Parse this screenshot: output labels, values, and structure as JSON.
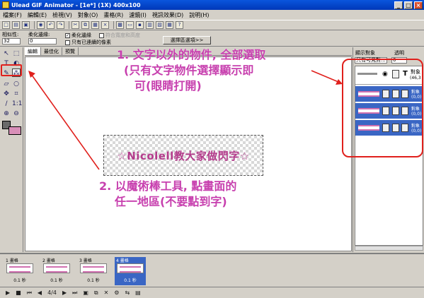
{
  "window": {
    "title": "Ulead GIF Animator - [1e*] (1X) 400x100",
    "minimize": "_",
    "maximize": "□",
    "close": "×"
  },
  "menu": [
    "檔案(F)",
    "編輯(E)",
    "檢視(V)",
    "對象(O)",
    "畫格(R)",
    "濾鏡(I)",
    "視訊效果(D)",
    "說明(H)"
  ],
  "options": {
    "tolerance_label": "相似性:",
    "tolerance_value": "32",
    "feather_label": "柔化邊緣:",
    "feather_value": "0",
    "antialias_label": "柔化邊緣",
    "fit_label": "符合寬度和高度",
    "continuous_label": "只有已連續的像素",
    "selection_button": "選擇區選項>>"
  },
  "tabs": [
    "編輯",
    "最佳化",
    "預覽"
  ],
  "canvas": {
    "text": "☆Nicolell教大家做閃字☆"
  },
  "annotations": {
    "note1": [
      "1. 文字以外的物件, 全部選取",
      "(只有文字物件選擇顯示即",
      "可(眼睛打開)"
    ],
    "note2": [
      "2. 以魔術棒工具, 點畫面的",
      "任一地區(不要點到字)"
    ]
  },
  "object_panel": {
    "label_visible": "顯示對象",
    "label_opacity": "透明",
    "filter_value": "只有可見對...",
    "opacity_value": "0",
    "text_icon": "T",
    "text_object_name": "對象",
    "text_object_pos": "(46,3",
    "rows": [
      {
        "name": "對象",
        "pos": "(0,0)"
      },
      {
        "name": "對象",
        "pos": "(0,0)"
      },
      {
        "name": "對象",
        "pos": "(0,0)"
      }
    ]
  },
  "frames": [
    {
      "label": "1 畫格",
      "delay": "0.1 秒"
    },
    {
      "label": "2 畫格",
      "delay": "0.1 秒"
    },
    {
      "label": "3 畫格",
      "delay": "0.1 秒"
    },
    {
      "label": "4 畫格",
      "delay": "0.1 秒"
    }
  ],
  "playbar": {
    "frame_counter": "4/4"
  },
  "colors": {
    "accent_annotation": "#c73fae",
    "highlight_red": "#e0201c",
    "selected_blue": "#3a66c4"
  }
}
